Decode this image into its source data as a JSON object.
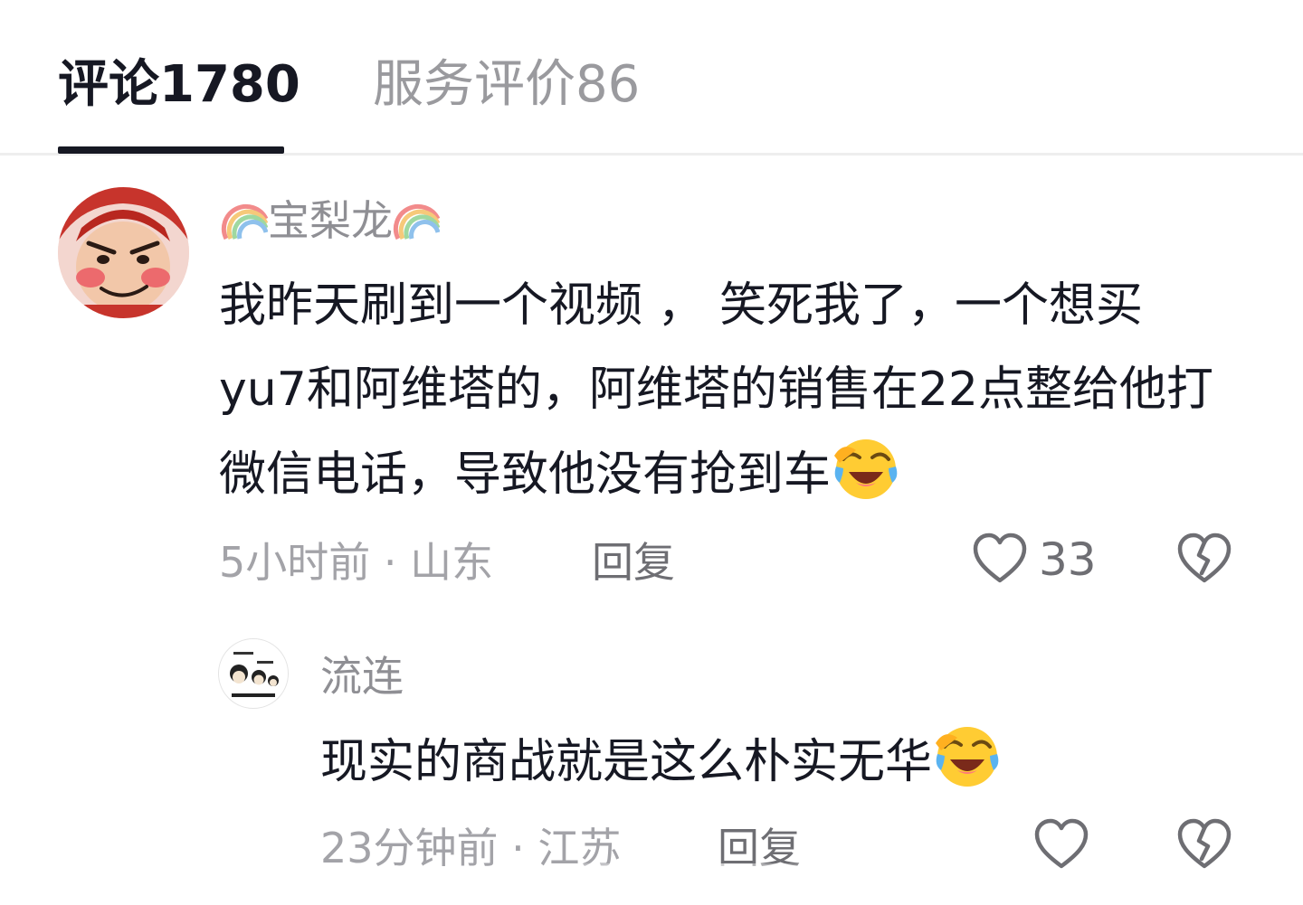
{
  "tabs": [
    {
      "label": "评论1780",
      "active": true
    },
    {
      "label": "服务评价86",
      "active": false
    }
  ],
  "comment": {
    "username": "宝梨龙",
    "username_decoration": "rainbow-icon",
    "text": "我昨天刷到一个视频 ， 笑死我了，一个想买yu7和阿维塔的，阿维塔的销售在22点整给他打微信电话，导致他没有抢到车",
    "text_emoji": "laughing-crying-emoji",
    "time": "5小时前",
    "location": "山东",
    "meta_separator": " · ",
    "reply_label": "回复",
    "like_count": "33",
    "like_icon": "heart-outline-icon",
    "dislike_icon": "broken-heart-icon"
  },
  "reply": {
    "username": "流连",
    "avatar_icon": "meme-avatar-icon",
    "text": "现实的商战就是这么朴实无华",
    "text_emoji": "laughing-crying-emoji",
    "time": "23分钟前",
    "location": "江苏",
    "meta_separator": " · ",
    "reply_label": "回复",
    "like_icon": "heart-outline-icon",
    "dislike_icon": "broken-heart-icon"
  },
  "colors": {
    "primary_text": "#161823",
    "secondary_text": "#a3a3a8",
    "tab_inactive": "#9a9a9e",
    "divider": "#eeeeee"
  }
}
